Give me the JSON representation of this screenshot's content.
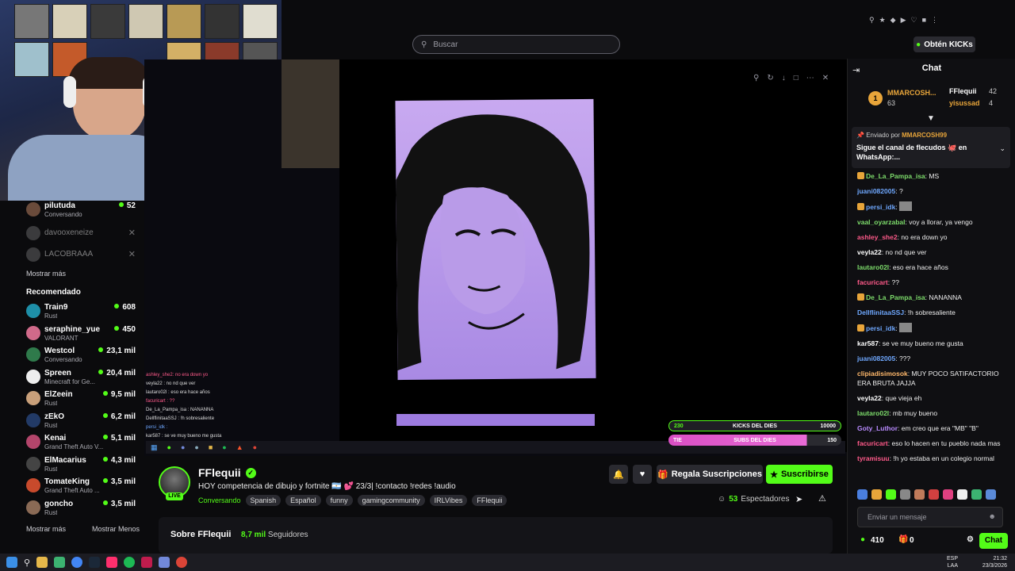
{
  "search": {
    "placeholder": "Buscar"
  },
  "header": {
    "kicks_button": "Obtén KICKs"
  },
  "sidebar": {
    "following": [
      {
        "name": "pilutuda",
        "status": "Conversando",
        "viewers": "52",
        "color": "#6a4b3b"
      },
      {
        "name": "davooxeneize",
        "offline": true
      },
      {
        "name": "LACOBRAAA",
        "offline": true
      }
    ],
    "show_more": "Mostrar más",
    "recommended_title": "Recomendado",
    "recommended": [
      {
        "name": "Train9",
        "game": "Rust",
        "viewers": "608",
        "color": "#1e8fa8"
      },
      {
        "name": "seraphine_yue",
        "game": "VALORANT",
        "viewers": "450",
        "color": "#d06a8a"
      },
      {
        "name": "Westcol",
        "game": "Conversando",
        "viewers": "23,1 mil",
        "color": "#2f7a4b"
      },
      {
        "name": "Spreen",
        "game": "Minecraft for Ge...",
        "viewers": "20,4 mil",
        "color": "#eeeeee"
      },
      {
        "name": "ElZeein",
        "game": "Rust",
        "viewers": "9,5 mil",
        "color": "#c9a07a"
      },
      {
        "name": "zEkO",
        "game": "Rust",
        "viewers": "6,2 mil",
        "color": "#223a66"
      },
      {
        "name": "Kenai",
        "game": "Grand Theft Auto V...",
        "viewers": "5,1 mil",
        "color": "#b3456b"
      },
      {
        "name": "ElMacarius",
        "game": "Rust",
        "viewers": "4,3 mil",
        "color": "#444444"
      },
      {
        "name": "TomateKing",
        "game": "Grand Theft Auto ...",
        "viewers": "3,5 mil",
        "color": "#c84a2c"
      },
      {
        "name": "goncho",
        "game": "Rust",
        "viewers": "3,5 mil",
        "color": "#8a6a55"
      }
    ],
    "show_more_bottom": "Mostrar más",
    "show_less": "Mostrar Menos"
  },
  "stream": {
    "mini_chat": [
      "ashley_she2: no era down yo",
      "veyla22 : no nd que ver",
      "lautaro02l : eso era hace años",
      "facuricart : ??",
      "De_La_Pampa_isa : NANANNA",
      "DellflinitaaSSJ : !h sobresaliente",
      "persi_idk :",
      "kar587 : se ve muy bueno me gusta"
    ],
    "kicks_bar_top": {
      "left": "230",
      "title": "KICKS DEL DIES",
      "right": "10000"
    },
    "kicks_bar_bottom": {
      "left": "TIE",
      "title": "SUBS DEL DIES",
      "right": "150"
    }
  },
  "channel": {
    "name": "FFlequii",
    "live": "LIVE",
    "title": "HOY competencia de dibujo y fortnite 🇦🇷 💕 23/3| !contacto !redes !audio",
    "category": "Conversando",
    "tags": [
      "Spanish",
      "Español",
      "funny",
      "gamingcommunity",
      "IRLVibes",
      "FFlequii"
    ],
    "gift_button": "Regala Suscripciones",
    "subscribe_button": "Suscribirse",
    "viewers": "53",
    "viewers_label": "Espectadores",
    "about_title": "Sobre FFlequii",
    "followers": "8,7 mil",
    "followers_label": "Seguidores"
  },
  "chat": {
    "title": "Chat",
    "leader1": {
      "rank": "1",
      "name": "MMARCOSH...",
      "count": "63"
    },
    "leader2": {
      "name": "FFlequii",
      "count": "42"
    },
    "leader3": {
      "name": "yisussad",
      "count": "4"
    },
    "pinned_by_label": "Enviado por",
    "pinned_by_user": "MMARCOSH99",
    "pinned_text": "Sigue el canal de flecudos 🐙 en WhatsApp:...",
    "messages": [
      {
        "user": "De_La_Pampa_isa",
        "text": "MS",
        "color": "#7ddc6b"
      },
      {
        "user": "juani082005",
        "text": "?",
        "color": "#6fa8ff"
      },
      {
        "user": "persi_idk",
        "text": "",
        "color": "#6fa8ff"
      },
      {
        "user": "vaal_oyarzabal",
        "text": "voy a llorar, ya vengo",
        "color": "#7ddc6b"
      },
      {
        "user": "ashley_she2",
        "text": "no era down yo",
        "color": "#ff5a8a"
      },
      {
        "user": "veyla22",
        "text": "no nd que ver",
        "color": "#ffffff"
      },
      {
        "user": "lautaro02l",
        "text": "eso era hace años",
        "color": "#7ddc6b"
      },
      {
        "user": "facuricart",
        "text": "??",
        "color": "#ff5a8a"
      },
      {
        "user": "De_La_Pampa_isa",
        "text": "NANANNA",
        "color": "#7ddc6b"
      },
      {
        "user": "DellflinitaaSSJ",
        "text": "!h sobresaliente",
        "color": "#6fa8ff"
      },
      {
        "user": "persi_idk",
        "text": "",
        "color": "#6fa8ff"
      },
      {
        "user": "kar587",
        "text": "se ve muy bueno me gusta",
        "color": "#ffffff"
      },
      {
        "user": "juani082005",
        "text": "???",
        "color": "#6fa8ff"
      },
      {
        "user": "clipiadisimosok",
        "text": "MUY POCO SATIFACTORIO ERA BRUTA JAJJA",
        "color": "#ffb86b"
      },
      {
        "user": "veyla22",
        "text": "que vieja eh",
        "color": "#ffffff"
      },
      {
        "user": "lautaro02l",
        "text": "mb muy bueno",
        "color": "#7ddc6b"
      },
      {
        "user": "Goty_Luthor",
        "text": "em creo que era \"MB\" \"B\"",
        "color": "#b98bff"
      },
      {
        "user": "facuricart",
        "text": "eso lo hacen en tu pueblo nada mas",
        "color": "#ff5a8a"
      },
      {
        "user": "tyramisuu",
        "text": "!h yo estaba en un colegio normal",
        "color": "#ff5a8a"
      }
    ],
    "input_placeholder": "Enviar un mensaje",
    "points": "410",
    "gifts": "0",
    "send_button": "Chat"
  },
  "os": {
    "lang": "ESP",
    "lang2": "LAA",
    "time": "21:32",
    "date": "23/3/2026"
  },
  "colors": {
    "accent": "#53fc18",
    "background": "#0b0b0d"
  }
}
